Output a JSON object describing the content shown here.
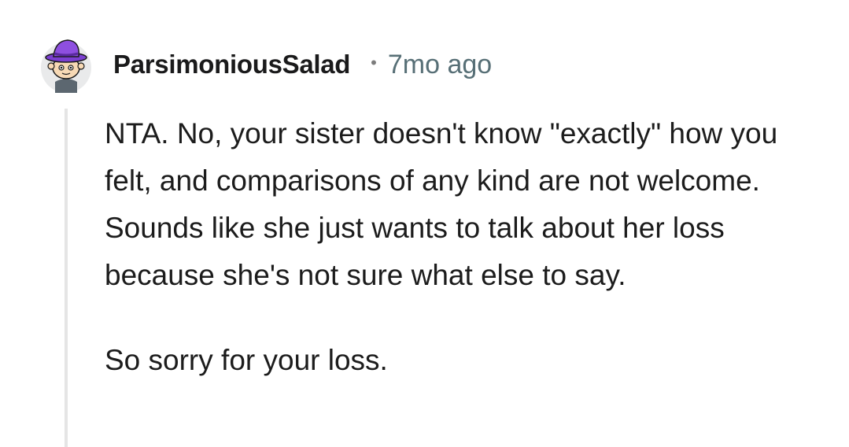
{
  "comment": {
    "author": "ParsimoniousSalad",
    "separator": "•",
    "timestamp": "7mo ago",
    "paragraphs": [
      "NTA. No, your sister doesn't know \"exactly\" how you felt, and comparisons of any kind are not welcome. Sounds like she just wants to talk about her loss because she's not sure what else to say.",
      "So sorry for your loss."
    ]
  },
  "avatar": {
    "icon": "snoo-avatar-purple-hat",
    "hat_color": "#7b3fd1",
    "background_color": "#e9eaeb"
  },
  "colors": {
    "username": "#1a1a1b",
    "timestamp": "#576f76",
    "thread_line": "#e5e5e5"
  }
}
